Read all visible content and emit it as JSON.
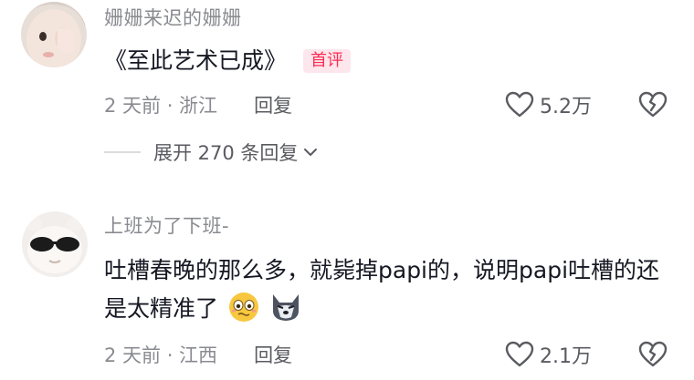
{
  "comments": [
    {
      "username": "姗姗来迟的姗姗",
      "text": "《至此艺术已成》",
      "tag": "首评",
      "time_location": "2 天前 · 浙江",
      "reply_label": "回复",
      "likes": "5.2万",
      "avatar_icon": "child-face-avatar"
    },
    {
      "username": "上班为了下班-",
      "text": "吐槽春晚的那么多，就毙掉papi的，说明papi吐槽的还是太精准了",
      "time_location": "2 天前 · 江西",
      "reply_label": "回复",
      "likes": "2.1万",
      "avatar_icon": "sunglasses-avatar",
      "emojis": [
        "worried-face-emoji",
        "wolf-emoji"
      ]
    }
  ],
  "expand_replies": {
    "label": "展开 270 条回复"
  },
  "icons": {
    "like": "heart-outline-icon",
    "dislike": "broken-heart-icon",
    "expand": "chevron-down-icon"
  },
  "colors": {
    "tag_text": "#fe2c55",
    "tag_bg": "#fde7ec",
    "meta": "#8a8b91"
  }
}
